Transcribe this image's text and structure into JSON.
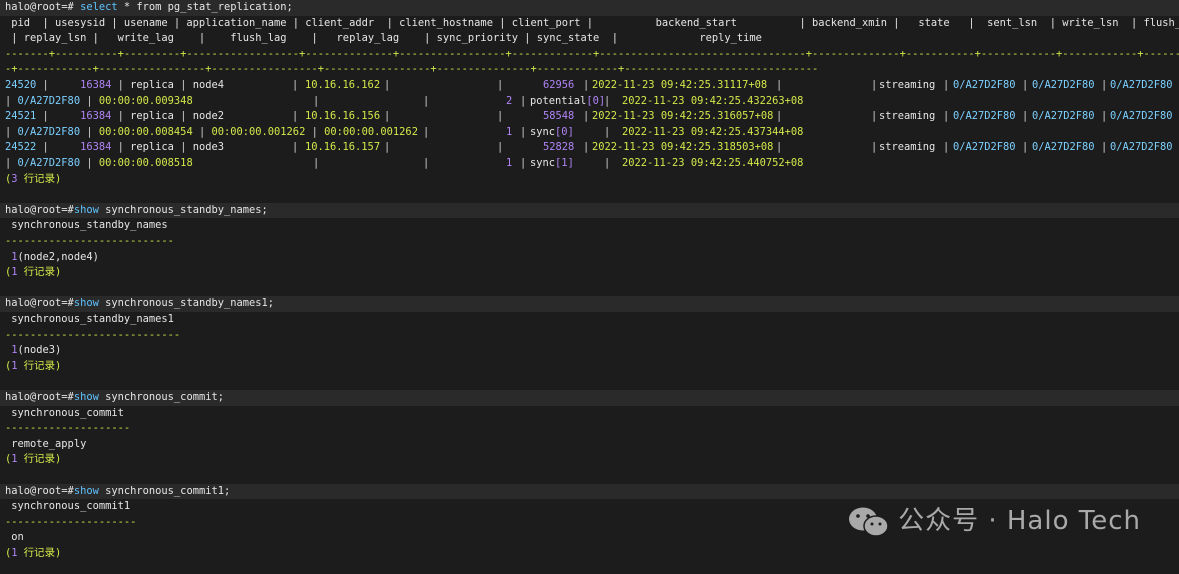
{
  "prompt": "halo@root=#",
  "query1": {
    "command": "select * from pg_stat_replication;",
    "header1": " pid  | usesysid | usename | application_name | client_addr  | client_hostname | client_port |          backend_start          | backend_xmin |   state   |  sent_lsn  | write_lsn  | flush_lsn",
    "header2": " | replay_lsn |   write_lag    |    flush_lag    |   replay_lag    | sync_priority | sync_state  |             reply_time",
    "sep1": "-------+----------+---------+------------------+--------------+-----------------+-------------+---------------------------------+--------------+-----------+------------+------------+-----------",
    "sep2": "-+------------+-----------------+-----------------+-----------------+---------------+-------------+-------------------------------",
    "rows": [
      {
        "pid": "24520",
        "usesysid": "16384",
        "usename": "replica",
        "application_name": "node4",
        "client_addr": "10.16.16.162",
        "client_port": "62956",
        "backend_start": "2022-11-23 09:42:25.31117+08",
        "state": "streaming",
        "sent_lsn": "0/A27D2F80",
        "write_lsn": "0/A27D2F80",
        "flush_lsn": "0/A27D2F80",
        "replay_lsn": "0/A27D2F80",
        "write_lag": "00:00:00.009348",
        "flush_lag": "",
        "replay_lag": "",
        "sync_priority": "2",
        "sync_state_word": "potential",
        "sync_state_idx": "0",
        "reply_time": "2022-11-23 09:42:25.432263+08"
      },
      {
        "pid": "24521",
        "usesysid": "16384",
        "usename": "replica",
        "application_name": "node2",
        "client_addr": "10.16.16.156",
        "client_port": "58548",
        "backend_start": "2022-11-23 09:42:25.316057+08",
        "state": "streaming",
        "sent_lsn": "0/A27D2F80",
        "write_lsn": "0/A27D2F80",
        "flush_lsn": "0/A27D2F80",
        "replay_lsn": "0/A27D2F80",
        "write_lag": "00:00:00.008454",
        "flush_lag": "00:00:00.001262",
        "replay_lag": "00:00:00.001262",
        "sync_priority": "1",
        "sync_state_word": "sync",
        "sync_state_idx": "0",
        "reply_time": "2022-11-23 09:42:25.437344+08"
      },
      {
        "pid": "24522",
        "usesysid": "16384",
        "usename": "replica",
        "application_name": "node3",
        "client_addr": "10.16.16.157",
        "client_port": "52828",
        "backend_start": "2022-11-23 09:42:25.318503+08",
        "state": "streaming",
        "sent_lsn": "0/A27D2F80",
        "write_lsn": "0/A27D2F80",
        "flush_lsn": "0/A27D2F80",
        "replay_lsn": "0/A27D2F80",
        "write_lag": "00:00:00.008518",
        "flush_lag": "",
        "replay_lag": "",
        "sync_priority": "1",
        "sync_state_word": "sync",
        "sync_state_idx": "1",
        "reply_time": "2022-11-23 09:42:25.440752+08"
      }
    ],
    "count_open": "(",
    "count_num": "3",
    "count_text": " 行记录)"
  },
  "blocks": [
    {
      "show": "show",
      "param": " synchronous_standby_names;",
      "col": " synchronous_standby_names",
      "dashes": "---------------------------",
      "val_num": " 1",
      "val_rest": "(node2,node4)",
      "count_num": "1",
      "count_text": " 行记录)"
    },
    {
      "show": "show",
      "param": " synchronous_standby_names1;",
      "col": " synchronous_standby_names1",
      "dashes": "----------------------------",
      "val_num": " 1",
      "val_rest": "(node3)",
      "count_num": "1",
      "count_text": " 行记录)"
    },
    {
      "show": "show",
      "param": " synchronous_commit;",
      "col": " synchronous_commit",
      "dashes": "--------------------",
      "val_num": "",
      "val_rest": " remote_apply",
      "count_num": "1",
      "count_text": " 行记录)"
    },
    {
      "show": "show",
      "param": " synchronous_commit1;",
      "col": " synchronous_commit1",
      "dashes": "---------------------",
      "val_num": "",
      "val_rest": " on",
      "count_num": "1",
      "count_text": " 行记录)"
    }
  ],
  "watermark": {
    "text": "公众号 · Halo Tech",
    "icon": "wechat-icon"
  }
}
